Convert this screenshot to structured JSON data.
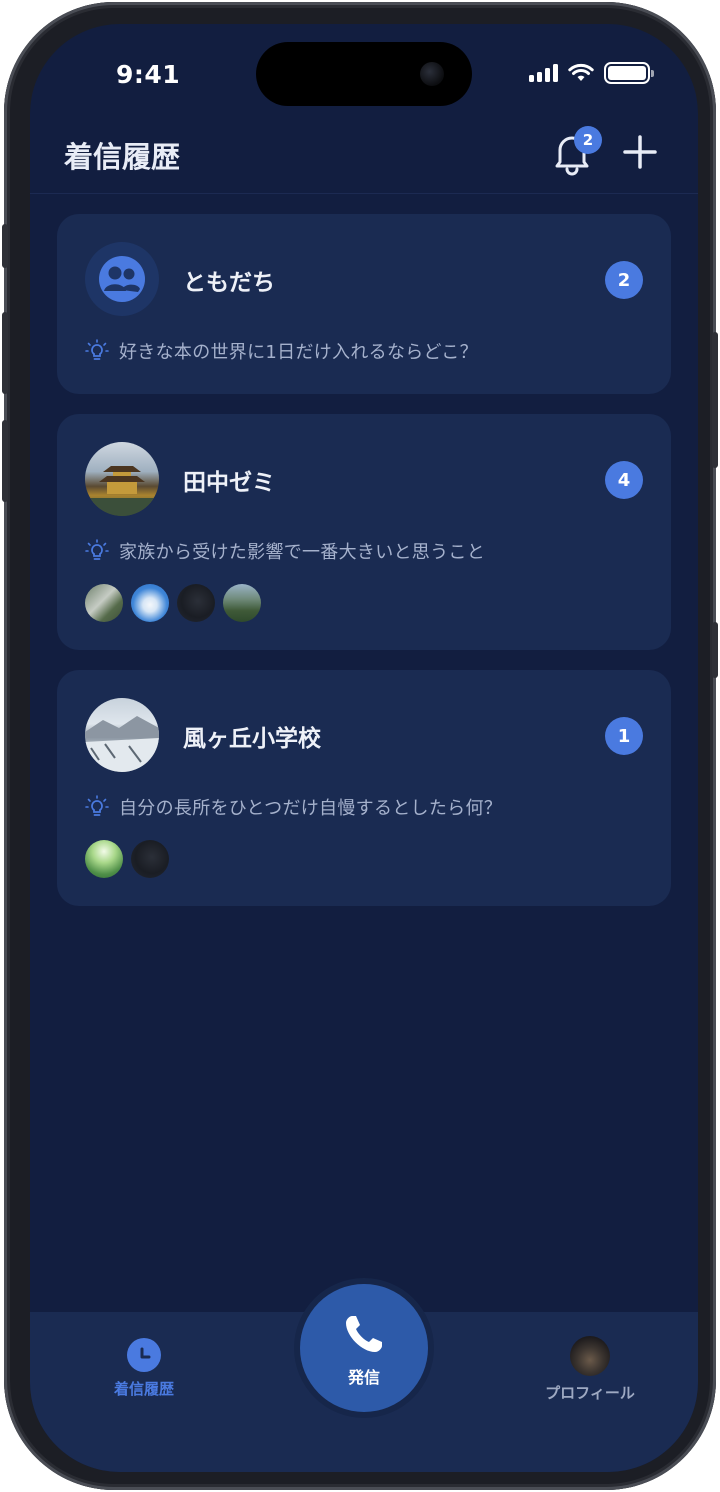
{
  "status_bar": {
    "time": "9:41"
  },
  "header": {
    "title": "着信履歴",
    "notification_count": "2"
  },
  "cards": [
    {
      "name": "ともだち",
      "count": "2",
      "topic": "好きな本の世界に1日だけ入れるならどこ？",
      "avatar": "group-icon"
    },
    {
      "name": "田中ゼミ",
      "count": "4",
      "topic": "家族から受けた影響で一番大きいと思うこと",
      "avatar": "temple-photo",
      "members": [
        "mountain-road-photo",
        "blue-sky-photo",
        "dark-cat-photo",
        "valley-photo"
      ]
    },
    {
      "name": "風ヶ丘小学校",
      "count": "1",
      "topic": "自分の長所をひとつだけ自慢するとしたら何？",
      "avatar": "snowy-landscape-photo",
      "members": [
        "forest-sunlight-photo",
        "dark-cat-photo"
      ]
    }
  ],
  "bottom_nav": {
    "history_label": "着信履歴",
    "call_label": "発信",
    "profile_label": "プロフィール"
  },
  "colors": {
    "background": "#121e40",
    "card": "#1a2b52",
    "accent": "#4a7ae0",
    "call_button": "#2d5aa9"
  }
}
